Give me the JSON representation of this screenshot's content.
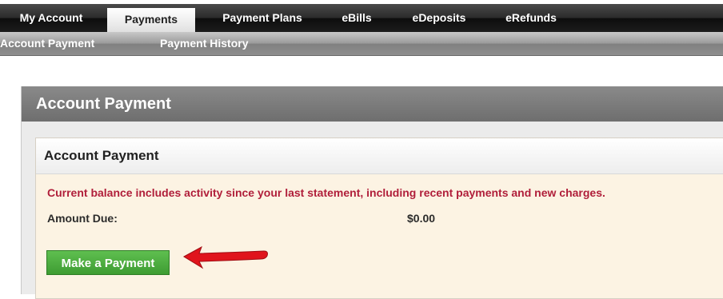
{
  "nav": {
    "tabs": [
      {
        "label": "My Account"
      },
      {
        "label": "Payments",
        "active": true
      },
      {
        "label": "Payment Plans"
      },
      {
        "label": "eBills"
      },
      {
        "label": "eDeposits"
      },
      {
        "label": "eRefunds"
      }
    ]
  },
  "subnav": {
    "items": [
      {
        "label": "Account Payment"
      },
      {
        "label": "Payment History"
      }
    ]
  },
  "page": {
    "title": "Account Payment"
  },
  "panel": {
    "title": "Account Payment",
    "notice": "Current balance includes activity since your last statement, including recent payments and new charges.",
    "amount_due_label": "Amount Due:",
    "amount_due_value": "$0.00",
    "make_payment_label": "Make a Payment"
  },
  "colors": {
    "notice": "#b01e3a",
    "button": "#4aa83d",
    "arrow": "#e0141c"
  },
  "annotation": {
    "icon": "arrow-pointing-left-icon"
  }
}
